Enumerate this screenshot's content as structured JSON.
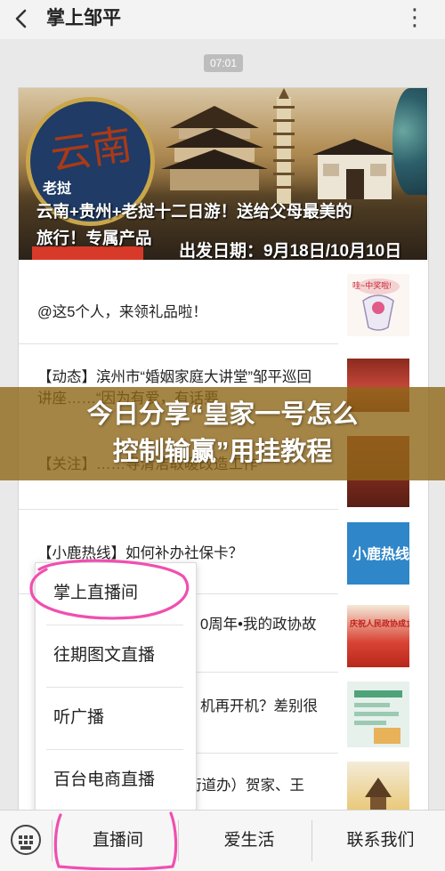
{
  "header": {
    "back_icon": "chevron-left-icon",
    "title": "掌上邹平",
    "more_icon": "more-dots-icon",
    "more_glyph": "⋮"
  },
  "chat": {
    "timestamp": "07:01"
  },
  "banner": {
    "logo_main": "云南",
    "logo_sub": "老挝",
    "caption_line1": "云南+贵州+老挝十二日游！送给父母最美的",
    "caption_line2": "旅行！专属产品",
    "date_text": "出发日期：9月18日/10月10日"
  },
  "articles": [
    {
      "text": "@这5个人，来领礼品啦！"
    },
    {
      "text": "【动态】滨州市“婚姻家庭大讲堂”邹平巡回讲座……“因为有爱，有话要"
    },
    {
      "text": "【关注】……导清洁取暖改造工作"
    },
    {
      "text": "【小鹿热线】如何补办社保卡？"
    },
    {
      "text": "0周年•我的政协故"
    },
    {
      "text": "机再开机？差别很"
    },
    {
      "text": "街道办）贺家、王"
    }
  ],
  "overlay": {
    "line1": "今日分享“皇家一号怎么",
    "line2": "控制输赢”用挂教程"
  },
  "menu": {
    "items": [
      {
        "label": "掌上直播间"
      },
      {
        "label": "往期图文直播"
      },
      {
        "label": "听广播"
      },
      {
        "label": "百台电商直播"
      }
    ]
  },
  "tabbar": {
    "keyboard_icon": "keyboard-icon",
    "tabs": [
      {
        "label": "直播间"
      },
      {
        "label": "爱生活"
      },
      {
        "label": "联系我们"
      }
    ]
  },
  "thumbs": [
    {
      "label": "哇~中奖啦!"
    },
    {
      "label": ""
    },
    {
      "label": ""
    },
    {
      "label": "小鹿热线"
    },
    {
      "label": "庆祝人民政协成立"
    },
    {
      "label": ""
    },
    {
      "label": ""
    }
  ],
  "colors": {
    "overlay": "#8f6618",
    "highlight_circle": "#f04fb0",
    "chip": "#d83a2a"
  }
}
